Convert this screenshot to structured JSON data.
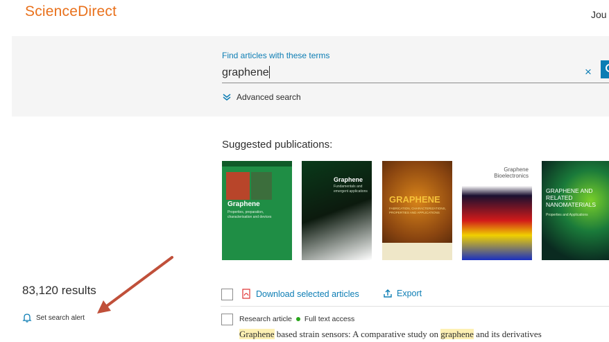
{
  "header": {
    "logo": "ScienceDirect",
    "nav_cut": "Jou"
  },
  "search": {
    "label": "Find articles with these terms",
    "value": "graphene",
    "clear": "×",
    "advanced": "Advanced search"
  },
  "suggested": {
    "heading": "Suggested publications:",
    "covers": [
      {
        "title": "Graphene",
        "subtitle": "Properties, preparation, characterisation and devices",
        "color": "#1a8a3e"
      },
      {
        "title": "Graphene",
        "subtitle": "Fundamentals and emergent applications",
        "color": "#0c1a0e"
      },
      {
        "title": "GRAPHENE",
        "subtitle": "FABRICATION, CHARACTERIZATIONS, PROPERTIES AND APPLICATIONS",
        "color": "#7a3a10"
      },
      {
        "title": "Graphene Bioelectronics",
        "subtitle": "",
        "color": "#1a1030"
      },
      {
        "title": "GRAPHENE AND RELATED NANOMATERIALS",
        "subtitle": "Properties and Applications",
        "color": "#0a2a20"
      }
    ]
  },
  "results": {
    "count": "83,120 results",
    "alert": "Set search alert",
    "download": "Download selected articles",
    "export": "Export",
    "item": {
      "type": "Research article",
      "access": "Full text access",
      "title_prefix": "Graphene",
      "title_mid": " based strain sensors: A comparative study on ",
      "title_hl": "graphene",
      "title_suffix": " and its derivatives"
    }
  },
  "colors": {
    "brand": "#e9711c",
    "link": "#0c7db4",
    "access_dot": "#29a61b",
    "highlight": "#fdf0b3"
  }
}
